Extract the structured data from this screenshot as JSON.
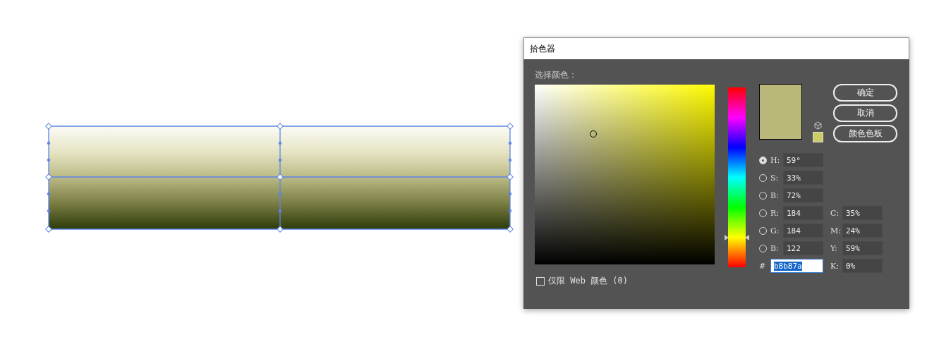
{
  "window": {
    "title": "拾色器"
  },
  "prompt": "选择颜色：",
  "hue_slider": {
    "level": 0.164
  },
  "swatches": [
    {
      "kind": "current",
      "color": "#b8b87a"
    },
    {
      "kind": "web_safe",
      "color": "#cccc66"
    }
  ],
  "buttons": [
    {
      "label": "确定"
    },
    {
      "label": "取消"
    },
    {
      "label": "颜色色板"
    }
  ],
  "channels": [
    {
      "label": "H:",
      "value": "59°",
      "selected": true
    },
    {
      "label": "S:",
      "value": "33%",
      "selected": false
    },
    {
      "label": "B:",
      "value": "72%",
      "selected": false
    },
    {
      "label": "R:",
      "value": "184",
      "selected": false
    },
    {
      "label": "G:",
      "value": "184",
      "selected": false
    },
    {
      "label": "B:",
      "value": "122",
      "selected": false
    }
  ],
  "hex": {
    "label": "#",
    "value": "b8b87a",
    "highlighted": true
  },
  "cmyk": [
    {
      "label": "C:",
      "value": "35%"
    },
    {
      "label": "M:",
      "value": "24%"
    },
    {
      "label": "Y:",
      "value": "59%"
    },
    {
      "label": "K:",
      "value": "0%"
    }
  ],
  "web_only": {
    "label": "仅限 Web 颜色 (0)",
    "checked": false
  }
}
